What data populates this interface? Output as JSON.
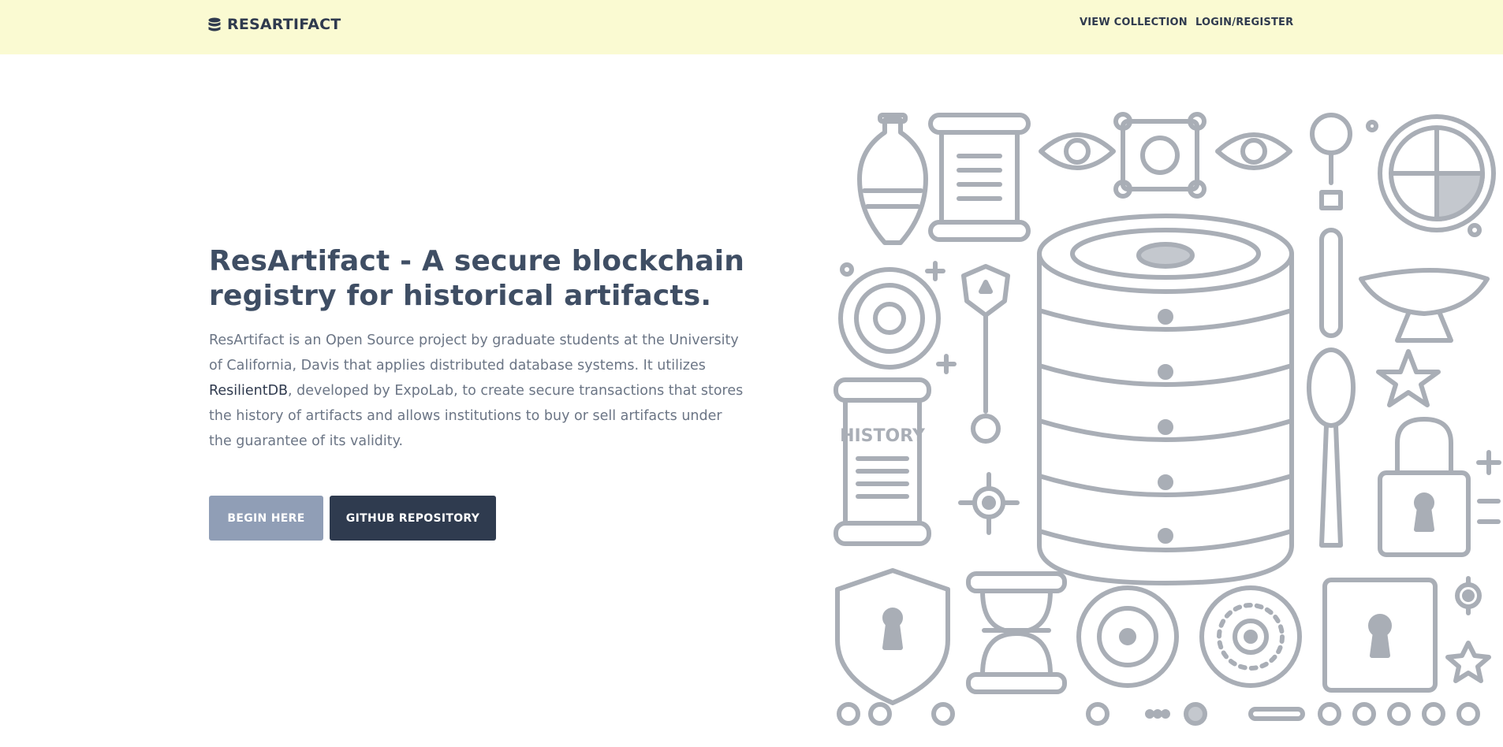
{
  "navbar": {
    "brand": "RESARTIFACT",
    "brand_icon": "database-icon",
    "links": [
      {
        "label": "VIEW COLLECTION"
      },
      {
        "label": "LOGIN/REGISTER"
      }
    ],
    "background": "#fafad2"
  },
  "hero": {
    "title": "ResArtifact - A secure blockchain registry for historical artifacts.",
    "description": {
      "part1": "ResArtifact is an Open Source project by graduate students at the University of California, Davis that applies distributed database systems. It utilizes ",
      "link": "ResilientDB",
      "part2": ", developed by ExpoLab, to create secure transactions that stores the history of artifacts and allows institutions to buy or sell artifacts under the guarantee of its validity."
    },
    "buttons": {
      "begin": "BEGIN HERE",
      "github": "GITHUB REPOSITORY"
    }
  },
  "illustration": {
    "scroll_label": "HISTORY"
  },
  "colors": {
    "heading": "#3f4e64",
    "body_text": "#6b7585",
    "primary_button": "#909eb6",
    "dark_button": "#2f3b4f",
    "icon_stroke": "#a9aeb6"
  }
}
